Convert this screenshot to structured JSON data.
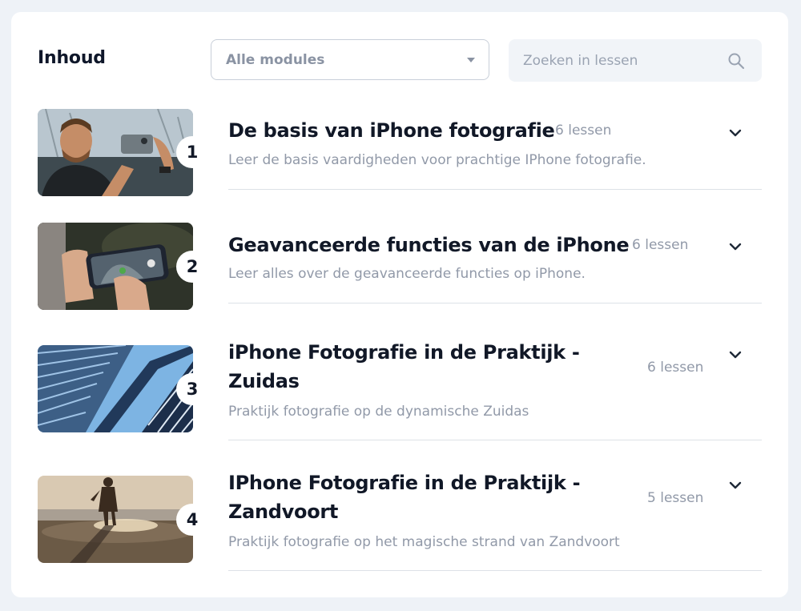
{
  "header": {
    "title": "Inhoud",
    "filter": {
      "selected": "Alle modules",
      "icon": "caret-down-icon"
    },
    "search": {
      "placeholder": "Zoeken in lessen",
      "value": "",
      "icon": "search-icon"
    }
  },
  "modules": [
    {
      "number": "1",
      "title": "De basis van iPhone fotografie",
      "lessons": "6 lessen",
      "description": "Leer de basis vaardigheden voor prachtige IPhone fotografie.",
      "thumbnail": "man-photographing-with-iphone"
    },
    {
      "number": "2",
      "title": "Geavanceerde functies van de iPhone",
      "lessons": "6 lessen",
      "description": "Leer alles over de geavanceerde functies op iPhone.",
      "thumbnail": "hands-holding-iphone-camera"
    },
    {
      "number": "3",
      "title": "iPhone Fotografie in de Praktijk - Zuidas",
      "lessons": "6 lessen",
      "description": "Praktijk fotografie op de dynamische Zuidas",
      "thumbnail": "glass-skyscraper"
    },
    {
      "number": "4",
      "title": "IPhone Fotografie in de Praktijk - Zandvoort",
      "lessons": "5 lessen",
      "description": "Praktijk fotografie op het magische strand van Zandvoort",
      "thumbnail": "child-on-beach-sunset"
    }
  ],
  "colors": {
    "background": "#eef2f7",
    "card": "#ffffff",
    "title_text": "#111827",
    "muted_text": "#9199a8",
    "divider": "#dde1e7"
  }
}
